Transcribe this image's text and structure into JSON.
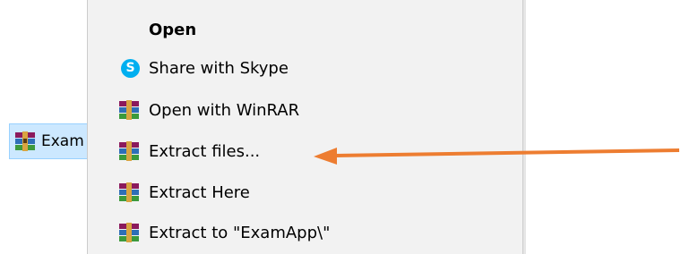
{
  "file": {
    "name": "Exam",
    "icon": "winrar-archive-icon"
  },
  "menu": {
    "items": [
      {
        "label": "Open",
        "icon": "",
        "bold": true
      },
      {
        "label": "Share with Skype",
        "icon": "skype-icon"
      },
      {
        "label": "Open with WinRAR",
        "icon": "winrar-icon"
      },
      {
        "label": "Extract files...",
        "icon": "winrar-icon"
      },
      {
        "label": "Extract Here",
        "icon": "winrar-icon"
      },
      {
        "label": "Extract to \"ExamApp\\\"",
        "icon": "winrar-icon"
      }
    ]
  },
  "annotation": {
    "arrow_color": "#ed7d31",
    "points_to": "Extract files..."
  },
  "colors": {
    "menu_background": "#f2f2f2",
    "selection_background": "#cce8ff",
    "selection_border": "#99d1ff",
    "skype_blue": "#00aff0"
  }
}
